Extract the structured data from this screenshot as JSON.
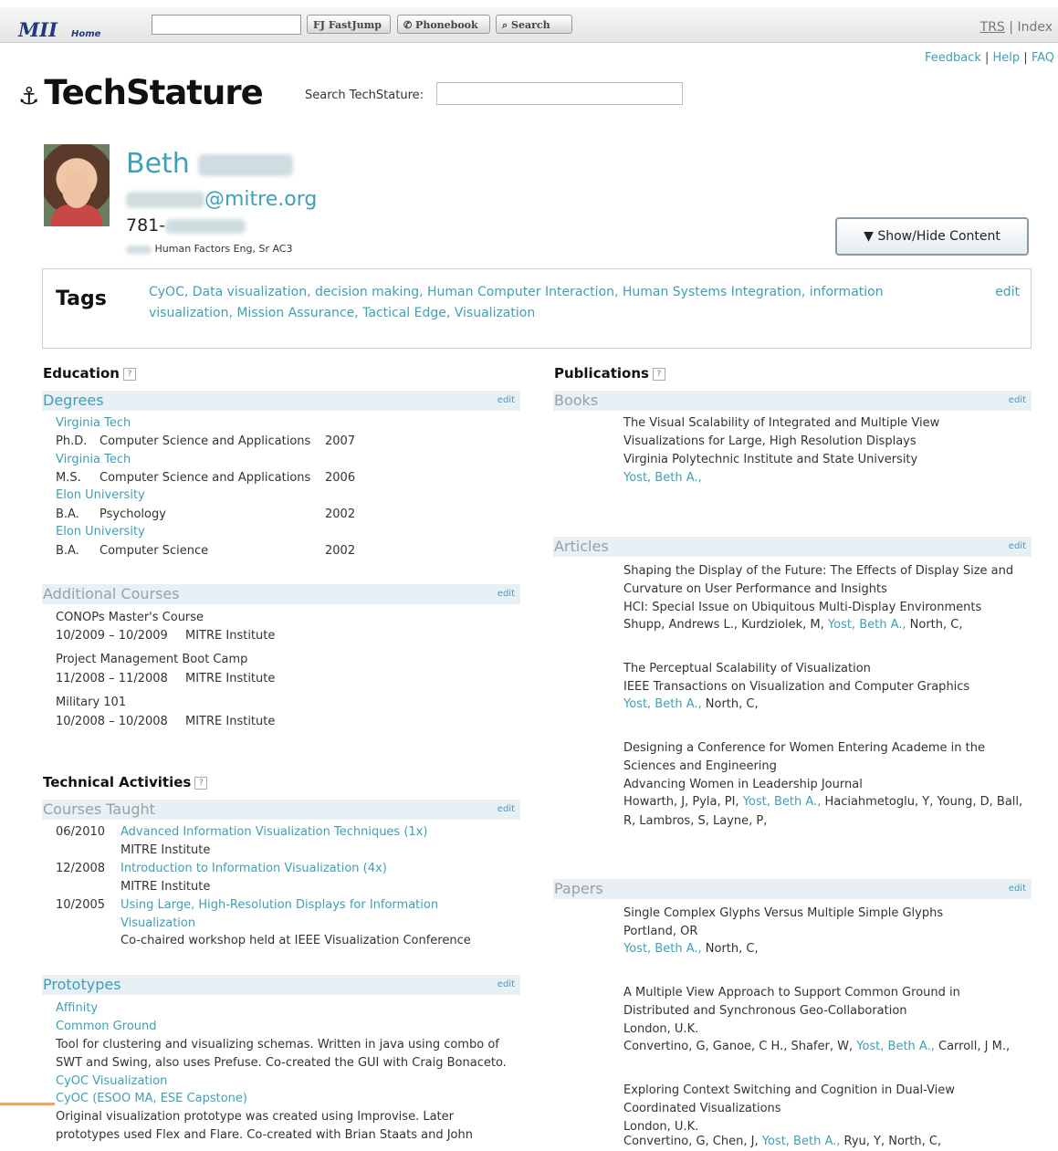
{
  "topbar": {
    "logo": "MII",
    "home": "Home",
    "fastjump": "FJ FastJump",
    "phonebook": "Phonebook",
    "search": "Search",
    "trs": "TRS",
    "index": "Index"
  },
  "utility_links": [
    "Feedback",
    "Help",
    "FAQ"
  ],
  "header": {
    "logo": "TechStature",
    "search_label": "Search TechStature:"
  },
  "profile": {
    "first_name": "Beth",
    "email_domain": "@mitre.org",
    "phone_prefix": "781-",
    "title": "Human Factors Eng, Sr AC3",
    "show_hide": "▼ Show/Hide Content"
  },
  "tags": {
    "label": "Tags",
    "text": "CyOC, Data visualization, decision making, Human Computer Interaction, Human Systems Integration, information visualization, Mission Assurance, Tactical Edge, Visualization",
    "edit": "edit"
  },
  "education": {
    "heading": "Education",
    "degrees_label": "Degrees",
    "edit": "edit",
    "degrees": [
      {
        "school": "Virginia Tech",
        "degree": "Ph.D.",
        "field": "Computer Science and Applications",
        "year": "2007"
      },
      {
        "school": "Virginia Tech",
        "degree": "M.S.",
        "field": "Computer Science and Applications",
        "year": "2006"
      },
      {
        "school": "Elon University",
        "degree": "B.A.",
        "field": "Psychology",
        "year": "2002"
      },
      {
        "school": "Elon University",
        "degree": "B.A.",
        "field": "Computer Science",
        "year": "2002"
      }
    ],
    "courses_label": "Additional Courses",
    "courses": [
      {
        "name": "CONOPs Master's Course",
        "dates": "10/2009 – 10/2009",
        "org": "MITRE Institute"
      },
      {
        "name": "Project Management Boot Camp",
        "dates": "11/2008 – 11/2008",
        "org": "MITRE Institute"
      },
      {
        "name": "Military 101",
        "dates": "10/2008 – 10/2008",
        "org": "MITRE Institute"
      }
    ]
  },
  "technical": {
    "heading": "Technical Activities",
    "taught_label": "Courses Taught",
    "taught": [
      {
        "date": "06/2010",
        "title": "Advanced Information Visualization Techniques (1x)",
        "org": "MITRE Institute"
      },
      {
        "date": "12/2008",
        "title": "Introduction to Information Visualization (4x)",
        "org": "MITRE Institute"
      },
      {
        "date": "10/2005",
        "title1": "Using Large, High-Resolution Displays for Information",
        "title2": "Visualization",
        "org": "Co-chaired workshop held at IEEE Visualization Conference"
      }
    ],
    "prototypes_label": "Prototypes",
    "prototypes": {
      "affinity": "Affinity",
      "common_ground": "Common Ground",
      "cg_desc1": "Tool for clustering and visualizing schemas. Written in java using combo of",
      "cg_desc2": "SWT and Swing, also uses Prefuse. Co-created the GUI with Craig Bonaceto.",
      "cyoc_vis": "CyOC Visualization",
      "cyoc_capstone": "CyOC (ESOO MA, ESE Capstone)",
      "cyoc_desc1": "Original visualization prototype was created using Improvise. Later",
      "cyoc_desc2": "prototypes used Flex and Flare. Co-created with Brian Staats and John"
    }
  },
  "publications": {
    "heading": "Publications",
    "books_label": "Books",
    "book": {
      "title1": "The Visual Scalability of Integrated and Multiple View",
      "title2": "Visualizations for Large, High Resolution Displays",
      "publisher": "Virginia Polytechnic Institute and State University",
      "author": "Yost, Beth A.,"
    },
    "articles_label": "Articles",
    "article1": {
      "title1": "Shaping the Display of the Future: The Effects of Display Size and",
      "title2": "Curvature on User Performance and Insights",
      "venue": "HCI: Special Issue on Ubiquitous Multi-Display Environments",
      "authors_pre": "Shupp, Andrews L., Kurdziolek, M,",
      "authors_self": "Yost, Beth A.,",
      "authors_post": "North, C,"
    },
    "article2": {
      "title": "The Perceptual Scalability of Visualization",
      "venue": "IEEE Transactions on Visualization and Computer Graphics",
      "authors_self": "Yost, Beth A.,",
      "authors_post": "North, C,"
    },
    "article3": {
      "title1": "Designing a Conference for Women Entering Academe in the",
      "title2": "Sciences and Engineering",
      "venue": "Advancing Women in Leadership Journal",
      "authors_pre": "Howarth, J, Pyla, PI,",
      "authors_self": "Yost, Beth A.,",
      "authors_post": "Haciahmetoglu, Y, Young, D, Ball,",
      "authors_line2": "R, Lambros, S, Layne, P,"
    },
    "papers_label": "Papers",
    "paper1": {
      "title": "Single Complex Glyphs Versus Multiple Simple Glyphs",
      "location": "Portland, OR",
      "authors_self": "Yost, Beth A.,",
      "authors_post": "North, C,"
    },
    "paper2": {
      "title1": "A Multiple View Approach to Support Common Ground in",
      "title2": "Distributed and Synchronous Geo-Collaboration",
      "location": "London, U.K.",
      "authors_pre": "Convertino, G, Ganoe, C H., Shafer, W,",
      "authors_self": "Yost, Beth A.,",
      "authors_post": "Carroll, J M.,"
    },
    "paper3": {
      "title1": "Exploring Context Switching and Cognition in Dual-View",
      "title2": "Coordinated Visualizations",
      "location": "London, U.K.",
      "authors_pre": "Convertino, G, Chen, J,",
      "authors_self": "Yost, Beth A.,",
      "authors_post": "Ryu, Y, North, C,"
    }
  }
}
